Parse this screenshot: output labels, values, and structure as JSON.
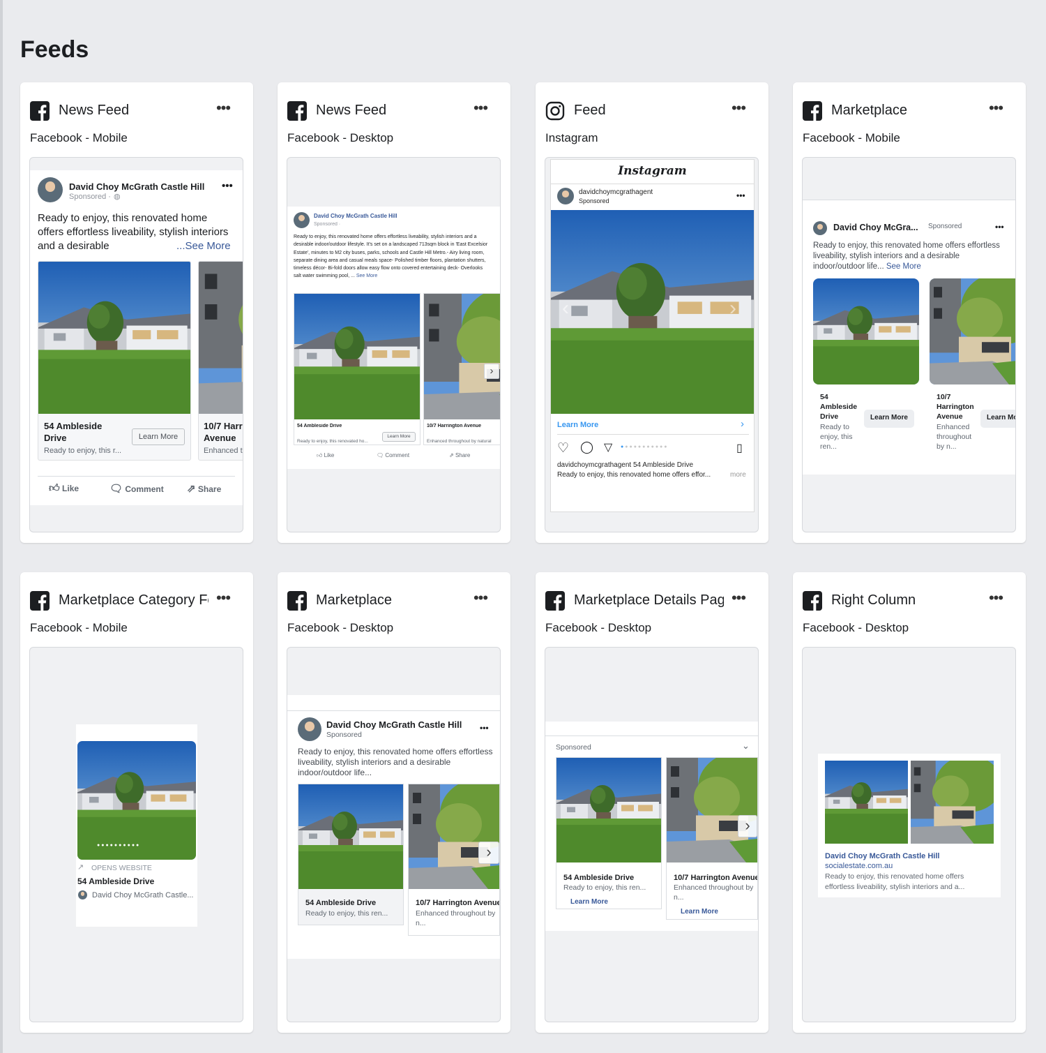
{
  "page": {
    "title": "Feeds"
  },
  "ad": {
    "advertiser": "David Choy McGrath Castle Hill",
    "advertiser_short": "David Choy McGra...",
    "advertiser_trunc": "David Choy McGrath Castle...",
    "sponsored": "Sponsored",
    "sponsored_dot": "Sponsored ·",
    "ig_handle": "davidchoymcgrathagent",
    "ig_caption": "davidchoymcgrathagent 54 Ambleside Drive",
    "ig_caption2": "Ready to enjoy, this renovated home offers effor...",
    "ig_more": "more",
    "ig_logo": "Instagram",
    "body_mobile_1": "Ready to enjoy, this renovated home",
    "body_mobile_2": "offers effortless liveability, stylish interiors",
    "body_mobile_3": "and a desirable",
    "see_more_ellipsis": "...See More",
    "see_more": "See More",
    "body_desktop_full": "Ready to enjoy, this renovated home offers effortless liveability, stylish interiors and a desirable indoor/outdoor lifestyle. It's set on a landscaped 713sqm block in 'East Excelsior Estate', minutes to M2 city buses, parks, schools and Castle Hill Metro.- Airy living room, separate dining area and casual meals space- Polished timber floors, plantation shutters, timeless décor- Bi-fold doors allow easy flow onto covered entertaining deck- Overlooks salt water swimming pool, ...",
    "body_market_mobile": "Ready to enjoy, this renovated home offers effortless liveability, stylish interiors and a desirable indoor/outdoor life...",
    "body_market_desktop": "Ready to enjoy, this renovated home offers effortless liveability, stylish interiors and a desirable indoor/outdoor life...",
    "learn_more": "Learn More",
    "like": "Like",
    "comment": "Comment",
    "share": "Share",
    "opens_website": "OPENS WEBSITE",
    "domain": "socialestate.com.au",
    "rc_body": "Ready to enjoy, this renovated home offers effortless liveability, stylish interiors and a..."
  },
  "listings": [
    {
      "title": "54 Ambleside Drive",
      "title_l1": "54 Ambleside",
      "title_l2": "Drive",
      "title_col": [
        "54",
        "Ambleside",
        "Drive"
      ],
      "desc": "Ready to enjoy, this r...",
      "desc_short": "Ready to enjoy, this renovated ho...",
      "desc_mid": "Ready to enjoy, this ren...",
      "desc_col": [
        "Ready to",
        "enjoy, this",
        "ren..."
      ]
    },
    {
      "title": "10/7 Harrington Avenue",
      "title_l1": "10/7 Harr",
      "title_l2": "Avenue",
      "title_col": [
        "10/7",
        "Harrington",
        "Avenue"
      ],
      "desc": "Enhanced t",
      "desc_short": "Enhanced throughout by natural",
      "desc_mid": "Enhanced throughout by",
      "desc_mid2": "n...",
      "desc_col": [
        "Enhanced",
        "throughout",
        "by n..."
      ]
    }
  ],
  "placements": [
    {
      "title": "News Feed",
      "subtitle": "Facebook - Mobile",
      "icon": "facebook-icon"
    },
    {
      "title": "News Feed",
      "subtitle": "Facebook - Desktop",
      "icon": "facebook-icon"
    },
    {
      "title": "Feed",
      "subtitle": "Instagram",
      "icon": "instagram-icon"
    },
    {
      "title": "Marketplace",
      "subtitle": "Facebook - Mobile",
      "icon": "facebook-icon"
    },
    {
      "title": "Marketplace Category Feed",
      "subtitle": "Facebook - Mobile",
      "icon": "facebook-icon"
    },
    {
      "title": "Marketplace",
      "subtitle": "Facebook - Desktop",
      "icon": "facebook-icon"
    },
    {
      "title": "Marketplace Details Page",
      "subtitle": "Facebook - Desktop",
      "icon": "facebook-icon"
    },
    {
      "title": "Right Column",
      "subtitle": "Facebook - Desktop",
      "icon": "facebook-icon"
    }
  ],
  "colors": {
    "facebook": "#1c1e21",
    "link": "#385898",
    "instagram_link": "#3897f0",
    "background": "#eaebee"
  }
}
